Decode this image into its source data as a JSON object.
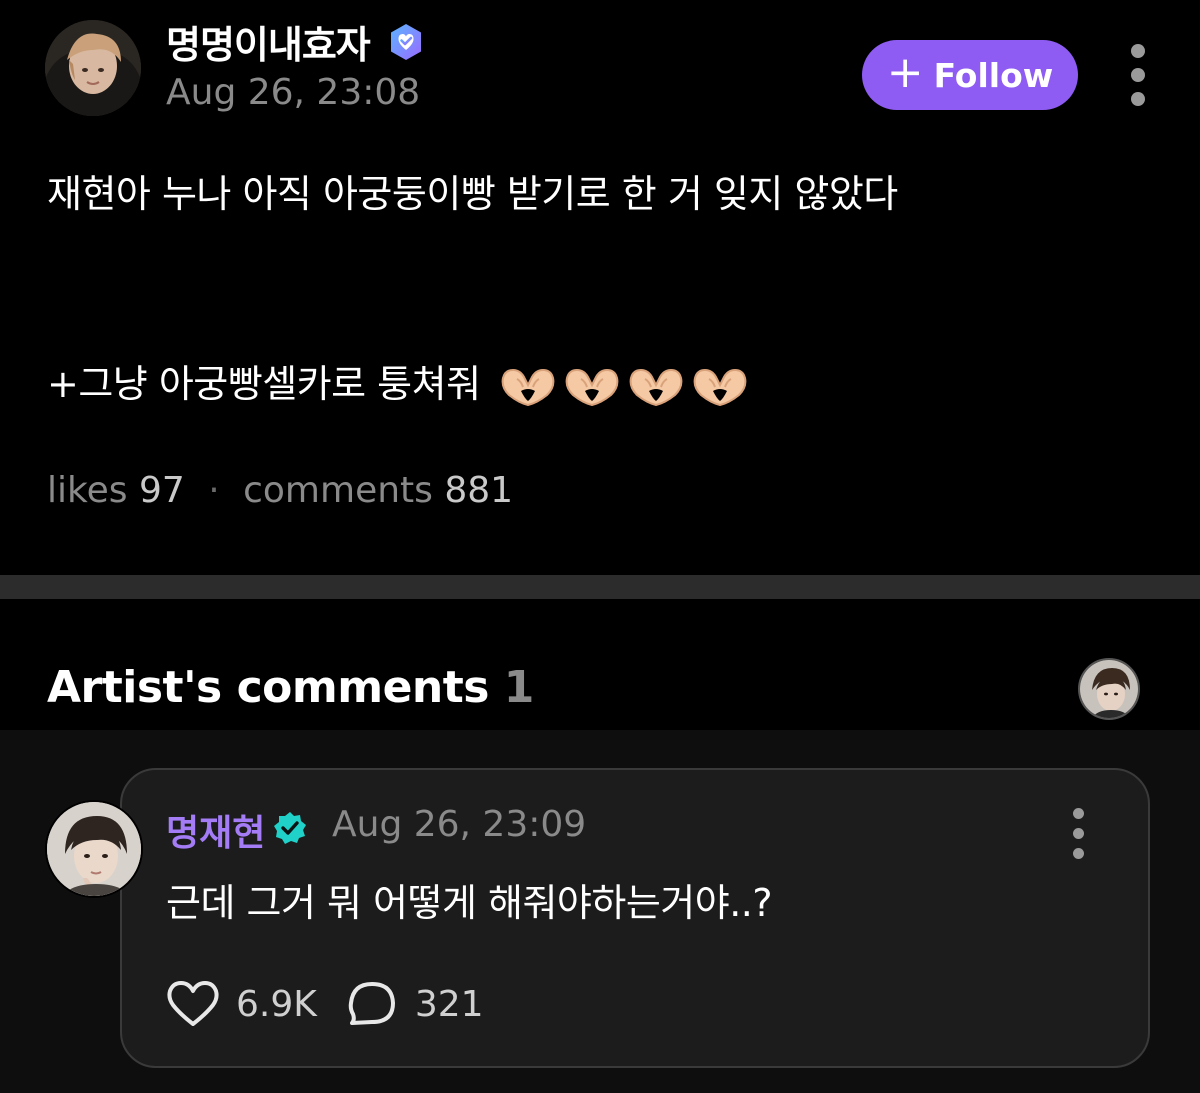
{
  "post": {
    "author_name": "명명이내효자",
    "timestamp": "Aug 26, 23:08",
    "follow_label": "Follow",
    "follow_icon": "plus-icon",
    "line1": "재현아 누나 아직 아궁둥이빵 받기로 한 거 잊지 않았다",
    "line2": "+그냥 아궁빵셀카로 퉁쳐줘",
    "emoji": "heart-hands",
    "emoji_count": 4,
    "likes_label": "likes",
    "likes_count": "97",
    "separator": "·",
    "comments_label": "comments",
    "comments_count": "881"
  },
  "artist_comments": {
    "title": "Artist's comments",
    "count": "1"
  },
  "comment": {
    "author_name": "명재현",
    "timestamp": "Aug 26, 23:09",
    "text": "근데 그거 뭐 어떻게 해줘야하는거야..?",
    "likes": "6.9K",
    "replies": "321"
  },
  "colors": {
    "background": "#000000",
    "accent_purple": "#8e5cf2",
    "artist_name": "#a37cf6",
    "verified_teal": "#1fd1c8",
    "muted_text": "#8a8a8a",
    "card_bg": "#1c1c1c"
  }
}
